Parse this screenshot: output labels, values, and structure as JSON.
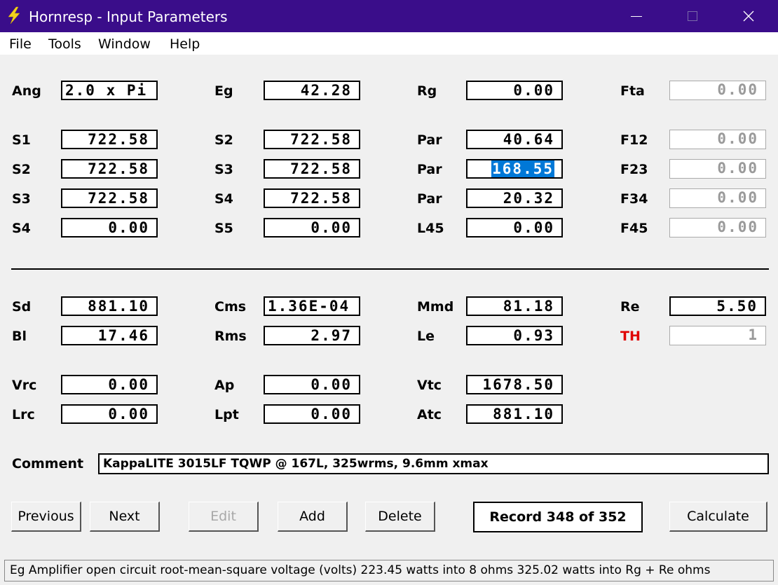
{
  "window": {
    "title": "Hornresp - Input Parameters",
    "accent": "#3a0d8a"
  },
  "menu": {
    "file": "File",
    "tools": "Tools",
    "window": "Window",
    "help": "Help"
  },
  "horn": {
    "ang": {
      "label": "Ang",
      "value": "2.0 x Pi"
    },
    "eg": {
      "label": "Eg",
      "value": "42.28"
    },
    "rg": {
      "label": "Rg",
      "value": "0.00"
    },
    "fta": {
      "label": "Fta",
      "value": "0.00"
    },
    "rows": [
      {
        "a_label": "S1",
        "a": "722.58",
        "b_label": "S2",
        "b": "722.58",
        "c_label": "Par",
        "c": "40.64",
        "d_label": "F12",
        "d": "0.00"
      },
      {
        "a_label": "S2",
        "a": "722.58",
        "b_label": "S3",
        "b": "722.58",
        "c_label": "Par",
        "c": "168.55",
        "d_label": "F23",
        "d": "0.00"
      },
      {
        "a_label": "S3",
        "a": "722.58",
        "b_label": "S4",
        "b": "722.58",
        "c_label": "Par",
        "c": "20.32",
        "d_label": "F34",
        "d": "0.00"
      },
      {
        "a_label": "S4",
        "a": "0.00",
        "b_label": "S5",
        "b": "0.00",
        "c_label": "L45",
        "c": "0.00",
        "d_label": "F45",
        "d": "0.00"
      }
    ]
  },
  "driver": {
    "sd": {
      "label": "Sd",
      "value": "881.10"
    },
    "cms": {
      "label": "Cms",
      "value": "1.36E-04"
    },
    "mmd": {
      "label": "Mmd",
      "value": "81.18"
    },
    "re": {
      "label": "Re",
      "value": "5.50"
    },
    "bl": {
      "label": "Bl",
      "value": "17.46"
    },
    "rms": {
      "label": "Rms",
      "value": "2.97"
    },
    "le": {
      "label": "Le",
      "value": "0.93"
    },
    "th": {
      "label": "TH",
      "value": "1",
      "color": "#e00000"
    }
  },
  "chamber": {
    "vrc": {
      "label": "Vrc",
      "value": "0.00"
    },
    "ap": {
      "label": "Ap",
      "value": "0.00"
    },
    "vtc": {
      "label": "Vtc",
      "value": "1678.50"
    },
    "lrc": {
      "label": "Lrc",
      "value": "0.00"
    },
    "lpt": {
      "label": "Lpt",
      "value": "0.00"
    },
    "atc": {
      "label": "Atc",
      "value": "881.10"
    }
  },
  "comment": {
    "label": "Comment",
    "value": "KappaLITE 3015LF TQWP @ 167L, 325wrms, 9.6mm xmax"
  },
  "buttons": {
    "previous": "Previous",
    "next": "Next",
    "edit": "Edit",
    "add": "Add",
    "delete": "Delete",
    "calculate": "Calculate"
  },
  "record": "Record 348 of 352",
  "status": "Eg  Amplifier open circuit root-mean-square voltage  (volts)   223.45 watts into 8 ohms   325.02 watts into Rg + Re ohms"
}
